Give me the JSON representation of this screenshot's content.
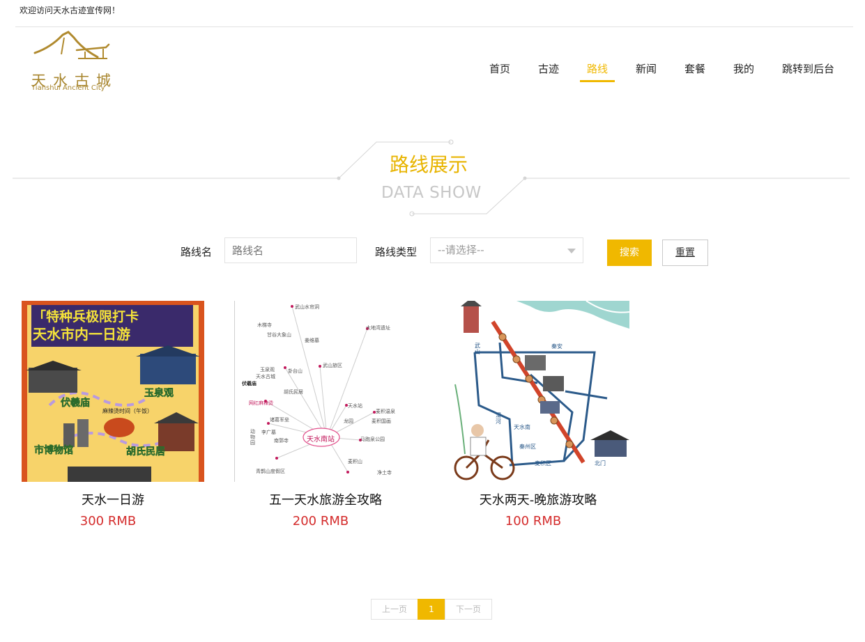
{
  "topbar": {
    "welcome": "欢迎访问天水古迹宣传网！"
  },
  "logo": {
    "text_cn": "天水古城",
    "text_en": "Tianshui Ancient City"
  },
  "nav": {
    "items": [
      {
        "label": "首页"
      },
      {
        "label": "古迹"
      },
      {
        "label": "路线"
      },
      {
        "label": "新闻"
      },
      {
        "label": "套餐"
      },
      {
        "label": "我的"
      },
      {
        "label": "跳转到后台"
      }
    ],
    "active_index": 2
  },
  "section": {
    "title_cn": "路线展示",
    "title_en": "DATA SHOW"
  },
  "search": {
    "name_label": "路线名",
    "name_placeholder": "路线名",
    "type_label": "路线类型",
    "type_selected": "--请选择--",
    "search_button": "搜索",
    "reset_button": "重置"
  },
  "routes": [
    {
      "name": "天水一日游",
      "price": "300 RMB",
      "poster": {
        "banner": "「特种兵极限打卡",
        "banner2": "天水市内一日游",
        "spots": [
          "伏羲庙",
          "玉泉观",
          "市博物馆",
          "胡氏民居"
        ],
        "note": "麻辣烫时间（午饭）"
      }
    },
    {
      "name": "五一天水旅游全攻略",
      "price": "200 RMB",
      "map": {
        "center": "天水南站",
        "nodes": [
          "武山水帘洞",
          "木梯寺",
          "甘谷大象山",
          "姜维墓",
          "大地湾遗址",
          "武山旅区",
          "卦台山",
          "玉泉观",
          "天水古城",
          "伏羲庙",
          "胡氏民居",
          "网红麻辣烫",
          "诸葛军垒",
          "李广墓",
          "南郭寺",
          "天水站",
          "龙园",
          "麦积温泉",
          "麦积国画",
          "马跑泉公园",
          "麦积山",
          "净土寺",
          "青鹊山度假区",
          "动物园"
        ]
      }
    },
    {
      "name": "天水两天-晚旅游攻略",
      "price": "100 RMB",
      "map": {
        "labels": [
          "武山",
          "秦安",
          "天水南",
          "渭河",
          "秦州区",
          "麦积区",
          "北门"
        ]
      }
    }
  ],
  "pagination": {
    "prev": "上一页",
    "current": "1",
    "next": "下一页"
  },
  "colors": {
    "accent": "#f0b800",
    "price": "#d42b2b",
    "logo": "#a8862e"
  }
}
